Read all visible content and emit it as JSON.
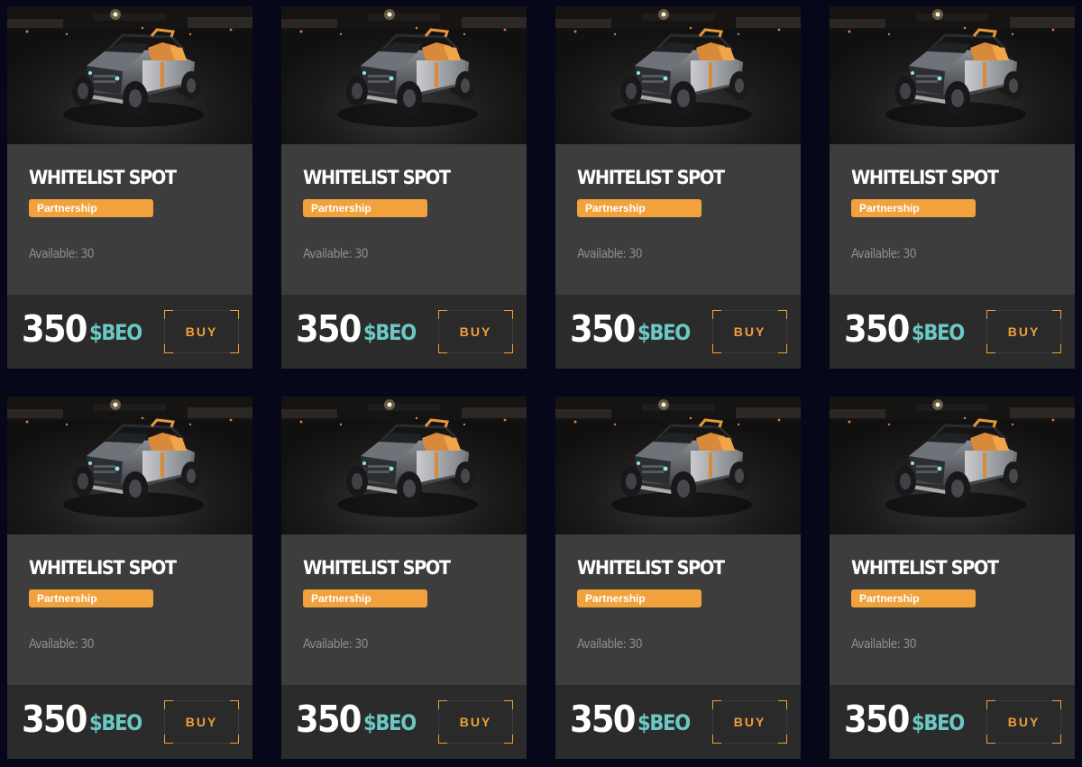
{
  "colors": {
    "page_background": "#07071a",
    "card_background": "#3d3d3e",
    "footer_background": "#2b2b2c",
    "badge": "#f1a23c",
    "currency": "#6cc8c4",
    "buy_accent": "#f0a03a",
    "availability_text": "#8d8d92"
  },
  "cards": [
    {
      "image_icon": "vehicle-image",
      "title": "WHITELIST SPOT",
      "badge": "Partnership",
      "available": "Available: 30",
      "price": "350",
      "currency": "$BEO",
      "buy_label": "BUY"
    },
    {
      "image_icon": "vehicle-image",
      "title": "WHITELIST SPOT",
      "badge": "Partnership",
      "available": "Available: 30",
      "price": "350",
      "currency": "$BEO",
      "buy_label": "BUY"
    },
    {
      "image_icon": "vehicle-image",
      "title": "WHITELIST SPOT",
      "badge": "Partnership",
      "available": "Available: 30",
      "price": "350",
      "currency": "$BEO",
      "buy_label": "BUY"
    },
    {
      "image_icon": "vehicle-image",
      "title": "WHITELIST SPOT",
      "badge": "Partnership",
      "available": "Available: 30",
      "price": "350",
      "currency": "$BEO",
      "buy_label": "BUY"
    },
    {
      "image_icon": "vehicle-image",
      "title": "WHITELIST SPOT",
      "badge": "Partnership",
      "available": "Available: 30",
      "price": "350",
      "currency": "$BEO",
      "buy_label": "BUY"
    },
    {
      "image_icon": "vehicle-image",
      "title": "WHITELIST SPOT",
      "badge": "Partnership",
      "available": "Available: 30",
      "price": "350",
      "currency": "$BEO",
      "buy_label": "BUY"
    },
    {
      "image_icon": "vehicle-image",
      "title": "WHITELIST SPOT",
      "badge": "Partnership",
      "available": "Available: 30",
      "price": "350",
      "currency": "$BEO",
      "buy_label": "BUY"
    },
    {
      "image_icon": "vehicle-image",
      "title": "WHITELIST SPOT",
      "badge": "Partnership",
      "available": "Available: 30",
      "price": "350",
      "currency": "$BEO",
      "buy_label": "BUY"
    }
  ]
}
